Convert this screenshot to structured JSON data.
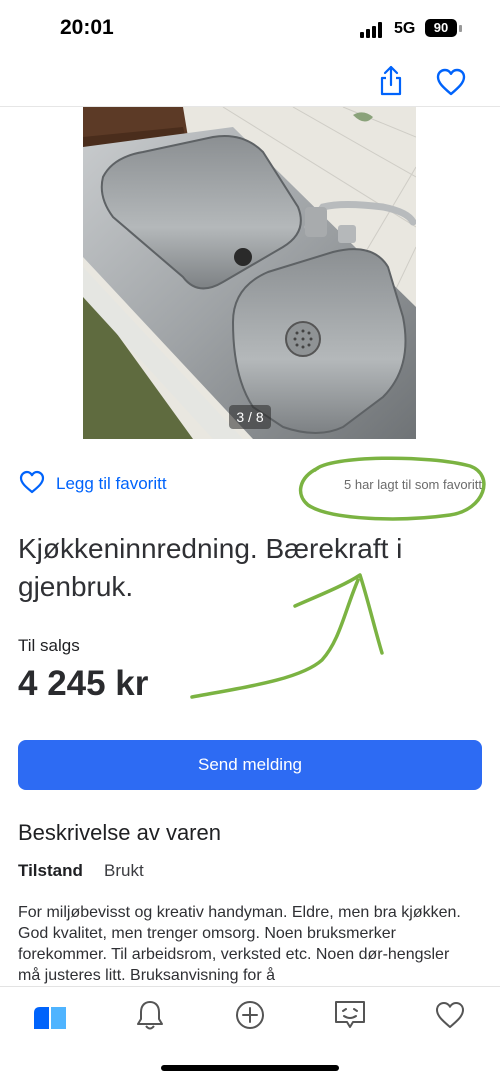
{
  "status_bar": {
    "time": "20:01",
    "network": "5G",
    "battery": "90"
  },
  "gallery": {
    "counter": "3 / 8"
  },
  "favorite": {
    "label": "Legg til favoritt",
    "count_text": "5 har lagt til som favoritt"
  },
  "listing": {
    "title": "Kjøkkeninnredning. Bærekraft i gjenbruk.",
    "sale_type": "Til salgs",
    "price": "4 245 kr"
  },
  "actions": {
    "send_message": "Send melding"
  },
  "description": {
    "heading": "Beskrivelse av varen",
    "condition_label": "Tilstand",
    "condition_value": "Brukt",
    "text": "For miljøbevisst og kreativ handyman. Eldre, men bra kjøkken. God kvalitet, men trenger omsorg. Noen bruksmerker forekommer. Til arbeidsrom, verksted etc. Noen dør-hengsler må justeres litt. Bruksanvisning for å"
  },
  "colors": {
    "accent": "#0063fb",
    "button": "#2d6bf3",
    "annotation": "#7bb342"
  },
  "icons": {
    "top": [
      "share-icon",
      "heart-icon"
    ],
    "bottom_nav": [
      "home-icon",
      "bell-icon",
      "add-icon",
      "messages-icon",
      "heart-icon"
    ]
  }
}
